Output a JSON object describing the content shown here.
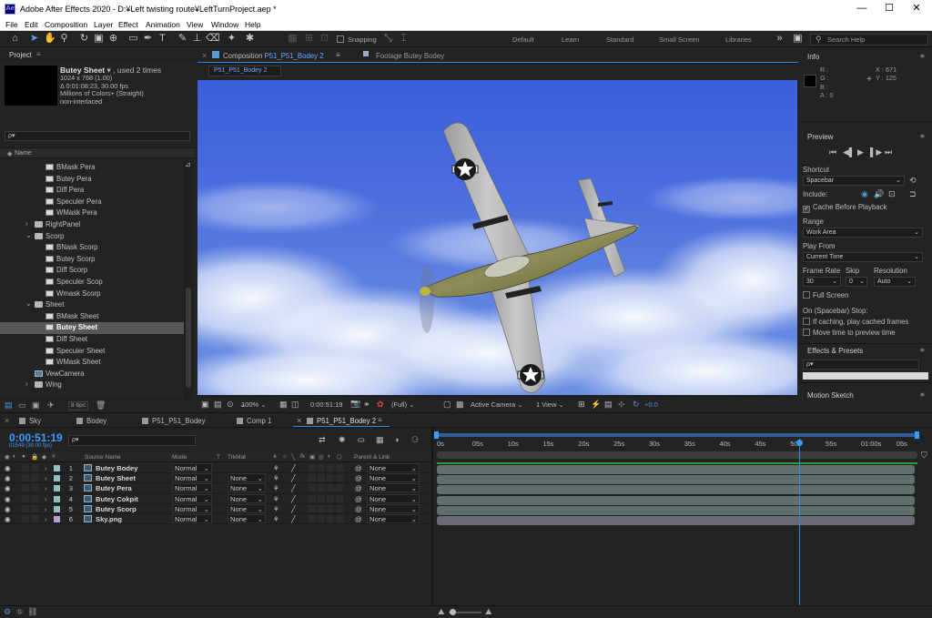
{
  "window": {
    "title": "Adobe After Effects 2020 - D:¥Left twisting route¥LeftTurnProject.aep *",
    "logo": "Ae"
  },
  "menu": [
    "File",
    "Edit",
    "Composition",
    "Layer",
    "Effect",
    "Animation",
    "View",
    "Window",
    "Help"
  ],
  "toolbar": {
    "snapping": "Snapping",
    "workspaces": [
      "Default",
      "Learn",
      "Standard",
      "Small Screen",
      "Libraries"
    ],
    "search_placeholder": "Search Help"
  },
  "project": {
    "title": "Project",
    "selected_name": "Butey Sheet",
    "used": ", used 2 times",
    "info_lines": [
      "1024 x 768 (1.00)",
      "Δ 0:01:08:23, 30.00 fps",
      "Millions of Colors+ (Straight)",
      "non-interlaced"
    ],
    "search_placeholder": "ρ▾",
    "column": "Name",
    "items": [
      {
        "name": "BMask Pera",
        "type": "img",
        "indent": 2
      },
      {
        "name": "Butey Pera",
        "type": "img",
        "indent": 2
      },
      {
        "name": "Diff Pera",
        "type": "img",
        "indent": 2
      },
      {
        "name": "Speculer Pera",
        "type": "img",
        "indent": 2
      },
      {
        "name": "WMask Pera",
        "type": "img",
        "indent": 2
      },
      {
        "name": "RightPanel",
        "type": "fold",
        "indent": 1,
        "arrow": "›"
      },
      {
        "name": "Scorp",
        "type": "fold",
        "indent": 1,
        "arrow": "⌄"
      },
      {
        "name": "BNask Scorp",
        "type": "img",
        "indent": 2
      },
      {
        "name": "Butey Scorp",
        "type": "img",
        "indent": 2
      },
      {
        "name": "Diff Scorp",
        "type": "img",
        "indent": 2
      },
      {
        "name": "Speculer Scop",
        "type": "img",
        "indent": 2
      },
      {
        "name": "Wmask Scorp",
        "type": "img",
        "indent": 2
      },
      {
        "name": "Sheet",
        "type": "fold",
        "indent": 1,
        "arrow": "⌄"
      },
      {
        "name": "BMask Sheet",
        "type": "img",
        "indent": 2
      },
      {
        "name": "Butey Sheet",
        "type": "img",
        "indent": 2,
        "selected": true
      },
      {
        "name": "Diff Sheet",
        "type": "img",
        "indent": 2
      },
      {
        "name": "Speculer Sheet",
        "type": "img",
        "indent": 2
      },
      {
        "name": "WMask Sheet",
        "type": "img",
        "indent": 2
      },
      {
        "name": "VewCamera",
        "type": "comp",
        "indent": 1
      },
      {
        "name": "Wing",
        "type": "fold",
        "indent": 1,
        "arrow": "›"
      }
    ],
    "bpc": "8 bpc"
  },
  "viewer": {
    "tab_comp_prefix": "Composition",
    "tab_comp_name": "P51_P51_Bodey 2",
    "tab_footage": "Footage Butey Bodey",
    "subtab": "P51_P51_Bodey 2",
    "zoom": "100%",
    "timecode": "0:00:51:19",
    "resolution": "(Full)",
    "camera": "Active Camera",
    "views": "1 View",
    "exposure": "+0.0"
  },
  "info": {
    "title": "Info",
    "r": "R :",
    "g": "G :",
    "b": "B :",
    "a": "A : 0",
    "x": "X : 671",
    "y": "Y : 125"
  },
  "preview": {
    "title": "Preview",
    "shortcut_label": "Shortcut",
    "shortcut": "Spacebar",
    "include": "Include:",
    "cache": "Cache Before Playback",
    "range_label": "Range",
    "range": "Work Area",
    "playfrom_label": "Play From",
    "playfrom": "Current Time",
    "fr_label": "Frame Rate",
    "skip_label": "Skip",
    "res_label": "Resolution",
    "fr": "30",
    "skip": "0",
    "res": "Auto",
    "fullscreen": "Full Screen",
    "stop_label": "On (Spacebar) Stop:",
    "stop1": "If caching, play cached frames",
    "stop2": "Move time to preview time"
  },
  "effects": {
    "title": "Effects & Presets",
    "search": "ρ▾"
  },
  "motion": {
    "title": "Motion Sketch"
  },
  "timeline": {
    "tabs": [
      {
        "name": "Sky",
        "color": "#8a8a8a"
      },
      {
        "name": "Bodey",
        "color": "#8a8a8a"
      },
      {
        "name": "P51_P51_Bodey",
        "color": "#8a8a8a"
      },
      {
        "name": "Comp 1",
        "color": "#8a8a8a"
      },
      {
        "name": "P51_P51_Bodey 2",
        "color": "#8a8a8a",
        "active": true
      }
    ],
    "current_time": "0:00:51:19",
    "frames": "01549 (30.00 fps)",
    "search": "ρ▾",
    "col_source": "Source Name",
    "col_mode": "Mode",
    "col_t": "T",
    "col_trkmat": "TrkMat",
    "col_parent": "Parent & Link",
    "ruler": [
      "0s",
      "05s",
      "10s",
      "15s",
      "20s",
      "25s",
      "30s",
      "35s",
      "40s",
      "45s",
      "50s",
      "55s",
      "01:00s",
      "05s"
    ],
    "playhead_fraction": 0.754,
    "layers": [
      {
        "num": "1",
        "name": "Butey Bodey",
        "mode": "Normal",
        "trkmat": "",
        "parent": "None",
        "color": "#8fbfbf"
      },
      {
        "num": "2",
        "name": "Butey Sheet",
        "mode": "Normal",
        "trkmat": "None",
        "parent": "None",
        "color": "#8fbfbf"
      },
      {
        "num": "3",
        "name": "Butey Pera",
        "mode": "Normal",
        "trkmat": "None",
        "parent": "None",
        "color": "#8fbfbf"
      },
      {
        "num": "4",
        "name": "Butey Cokpit",
        "mode": "Normal",
        "trkmat": "None",
        "parent": "None",
        "color": "#8fbfbf"
      },
      {
        "num": "5",
        "name": "Butey Scorp",
        "mode": "Normal",
        "trkmat": "None",
        "parent": "None",
        "color": "#8fbfbf"
      },
      {
        "num": "6",
        "name": "Sky.png",
        "mode": "Normal",
        "trkmat": "None",
        "parent": "None",
        "color": "#b0a0d8"
      }
    ]
  },
  "colors": {
    "accent": "#2d8ceb",
    "timecode": "#3b9cff",
    "workarea": "#2d5f9a",
    "bar_green": "#2e9c3b"
  }
}
